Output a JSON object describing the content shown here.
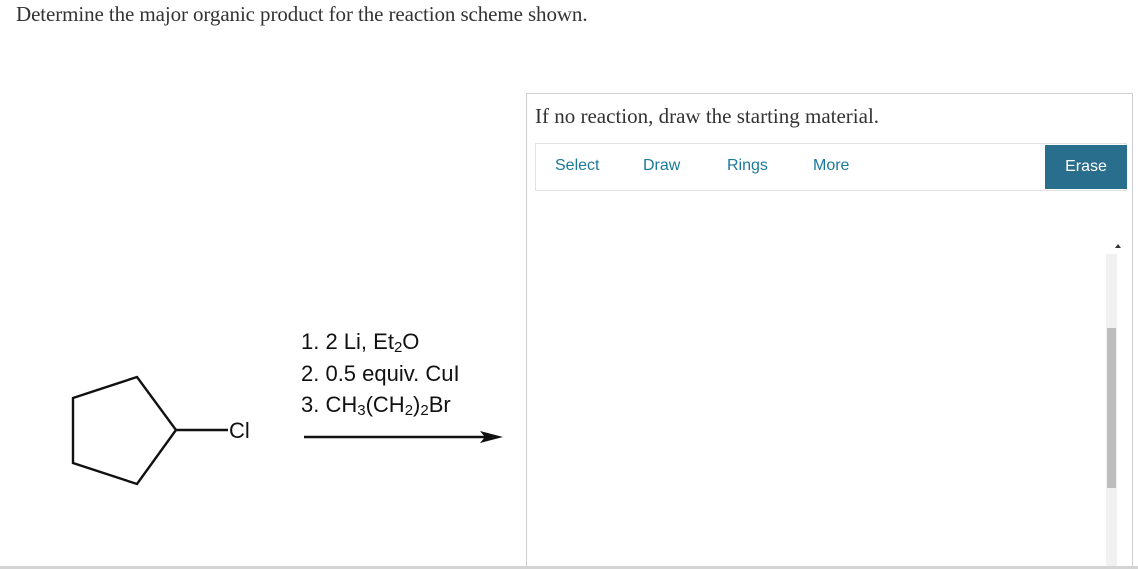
{
  "question": {
    "text": "Determine the major organic product for the reaction scheme shown."
  },
  "scheme": {
    "substituent_label": "Cl",
    "reagents": {
      "step1": {
        "prefix": "1. 2 Li, Et",
        "sub": "2",
        "suffix": "O"
      },
      "step2": {
        "text": "2. 0.5 equiv. CuI"
      },
      "step3": {
        "a": "3. CH",
        "sub1": "3",
        "b": "(CH",
        "sub2": "2",
        "c": ")",
        "sub3": "2",
        "d": "Br"
      }
    }
  },
  "panel": {
    "prompt": "If no reaction, draw the starting material.",
    "toolbar": {
      "select": "Select",
      "draw": "Draw",
      "rings": "Rings",
      "more": "More",
      "erase": "Erase"
    }
  },
  "colors": {
    "tool_text": "#1a7a9a",
    "erase_bg": "#2a6e8e"
  }
}
